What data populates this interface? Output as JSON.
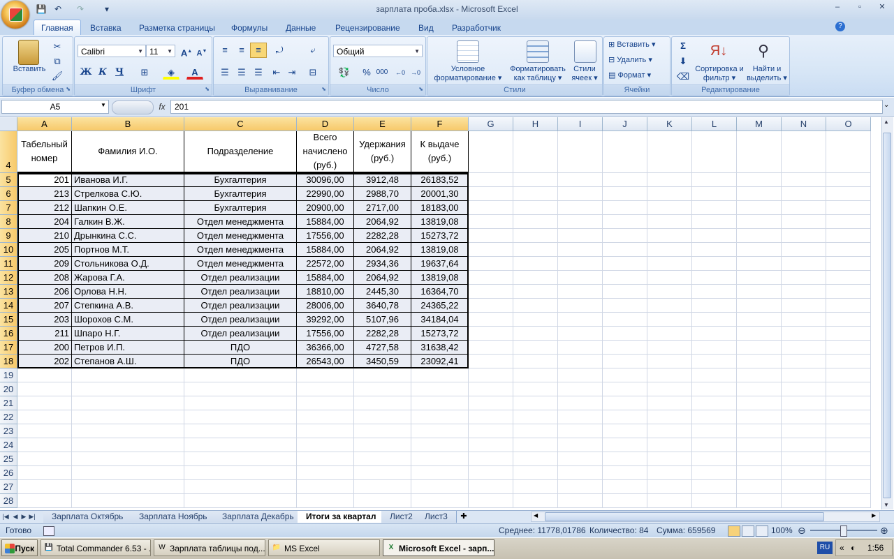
{
  "window": {
    "title": "зарплата проба.xlsx - Microsoft Excel",
    "min": "–",
    "max": "▫",
    "close": "✕"
  },
  "qat": {
    "save": "💾",
    "undo": "↶",
    "redo": "↷",
    "customize": "▾"
  },
  "ribbon_tabs": [
    "Главная",
    "Вставка",
    "Разметка страницы",
    "Формулы",
    "Данные",
    "Рецензирование",
    "Вид",
    "Разработчик"
  ],
  "ribbon": {
    "clipboard": {
      "label": "Буфер обмена",
      "paste": "Вставить"
    },
    "font": {
      "label": "Шрифт",
      "name": "Calibri",
      "size": "11",
      "bold": "Ж",
      "italic": "К",
      "underline": "Ч"
    },
    "alignment": {
      "label": "Выравнивание"
    },
    "number": {
      "label": "Число",
      "format": "Общий",
      "percent": "%",
      "thousands": "000"
    },
    "styles": {
      "label": "Стили",
      "cond_format": "Условное форматирование ▾",
      "as_table": "Форматировать как таблицу ▾",
      "cell_styles": "Стили ячеек ▾"
    },
    "cells": {
      "label": "Ячейки",
      "insert": "Вставить",
      "delete": "Удалить",
      "format": "Формат"
    },
    "editing": {
      "label": "Редактирование",
      "sum": "Σ",
      "sort": "Сортировка и фильтр ▾",
      "find": "Найти и выделить ▾"
    }
  },
  "formula_bar": {
    "name_box": "A5",
    "fx": "fx",
    "value": "201"
  },
  "columns": [
    "A",
    "B",
    "C",
    "D",
    "E",
    "F",
    "G",
    "H",
    "I",
    "J",
    "K",
    "L",
    "M",
    "N",
    "O"
  ],
  "table": {
    "headers": [
      "Табельный номер",
      "Фамилия И.О.",
      "Подразделение",
      "Всего начислено (руб.)",
      "Удержания (руб.)",
      "К выдаче (руб.)"
    ],
    "rows": [
      [
        "201",
        "Иванова И.Г.",
        "Бухгалтерия",
        "30096,00",
        "3912,48",
        "26183,52"
      ],
      [
        "213",
        "Стрелкова С.Ю.",
        "Бухгалтерия",
        "22990,00",
        "2988,70",
        "20001,30"
      ],
      [
        "212",
        "Шапкин О.Е.",
        "Бухгалтерия",
        "20900,00",
        "2717,00",
        "18183,00"
      ],
      [
        "204",
        "Галкин В.Ж.",
        "Отдел менеджмента",
        "15884,00",
        "2064,92",
        "13819,08"
      ],
      [
        "210",
        "Дрынкина С.С.",
        "Отдел менеджмента",
        "17556,00",
        "2282,28",
        "15273,72"
      ],
      [
        "205",
        "Портнов М.Т.",
        "Отдел менеджмента",
        "15884,00",
        "2064,92",
        "13819,08"
      ],
      [
        "209",
        "Стольникова О.Д.",
        "Отдел менеджмента",
        "22572,00",
        "2934,36",
        "19637,64"
      ],
      [
        "208",
        "Жарова Г.А.",
        "Отдел реализации",
        "15884,00",
        "2064,92",
        "13819,08"
      ],
      [
        "206",
        "Орлова Н.Н.",
        "Отдел реализации",
        "18810,00",
        "2445,30",
        "16364,70"
      ],
      [
        "207",
        "Степкина А.В.",
        "Отдел реализации",
        "28006,00",
        "3640,78",
        "24365,22"
      ],
      [
        "203",
        "Шорохов С.М.",
        "Отдел реализации",
        "39292,00",
        "5107,96",
        "34184,04"
      ],
      [
        "211",
        "Шпаро Н.Г.",
        "Отдел реализации",
        "17556,00",
        "2282,28",
        "15273,72"
      ],
      [
        "200",
        "Петров И.П.",
        "ПДО",
        "36366,00",
        "4727,58",
        "31638,42"
      ],
      [
        "202",
        "Степанов А.Ш.",
        "ПДО",
        "26543,00",
        "3450,59",
        "23092,41"
      ]
    ]
  },
  "row_numbers": [
    "4",
    "5",
    "6",
    "7",
    "8",
    "9",
    "10",
    "11",
    "12",
    "13",
    "14",
    "15",
    "16",
    "17",
    "18",
    "19",
    "20",
    "21",
    "22",
    "23",
    "24",
    "25",
    "26",
    "27",
    "28"
  ],
  "sheet_tabs": [
    "Зарплата Октябрь",
    "Зарплата Ноябрь",
    "Зарплата Декабрь",
    "Итоги за квартал",
    "Лист2",
    "Лист3"
  ],
  "active_sheet": "Итоги за квартал",
  "status": {
    "ready": "Готово",
    "average": "Среднее: 11778,01786",
    "count": "Количество: 84",
    "sum": "Сумма: 659569",
    "zoom": "100%"
  },
  "taskbar": {
    "start": "Пуск",
    "tasks": [
      "Total Commander 6.53 - ...",
      "Зарплата таблицы под...",
      "MS Excel",
      "Microsoft Excel - зарп..."
    ],
    "lang": "RU",
    "clock": "1:56"
  }
}
